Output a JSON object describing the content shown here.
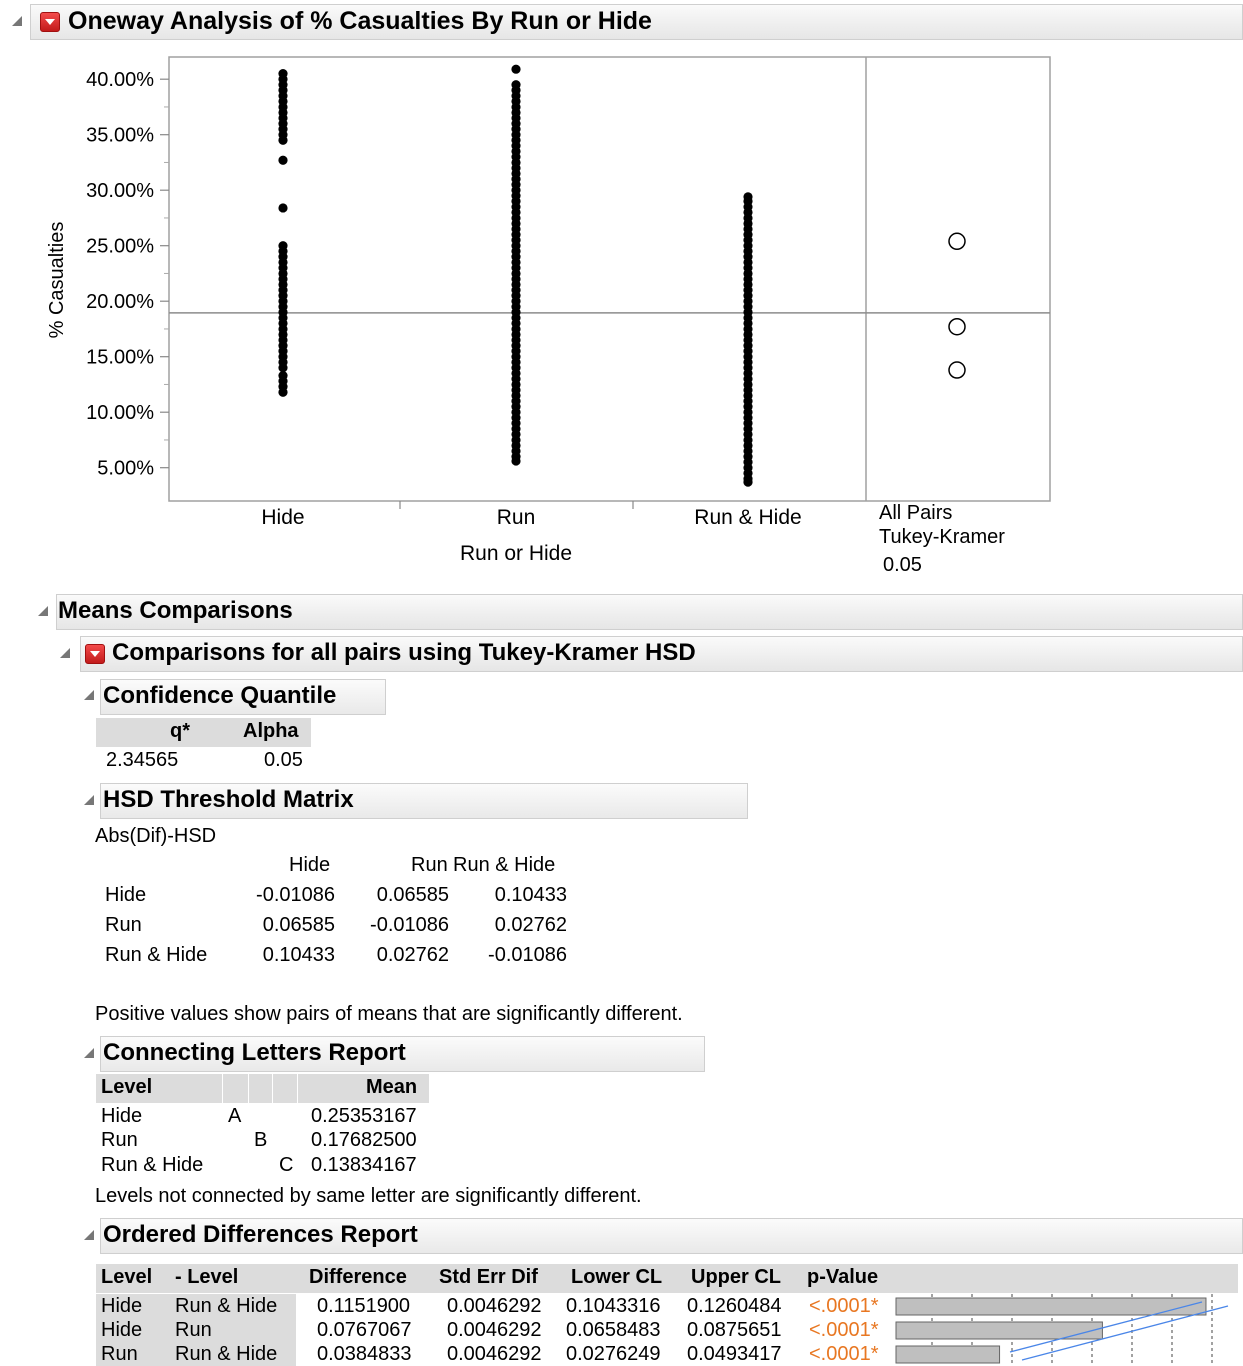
{
  "report": {
    "title": "Oneway Analysis of % Casualties By Run or Hide"
  },
  "chart_data": {
    "type": "scatter",
    "ylabel": "% Casualties",
    "xlabel": "Run or Hide",
    "categories": [
      "Hide",
      "Run",
      "Run & Hide"
    ],
    "y_ticks": [
      "5.00%",
      "10.00%",
      "15.00%",
      "20.00%",
      "25.00%",
      "30.00%",
      "35.00%",
      "40.00%"
    ],
    "ylim": [
      0.02,
      0.42
    ],
    "grand_mean": 0.1895,
    "series": [
      {
        "category": "Hide",
        "points": [
          0.118,
          0.123,
          0.128,
          0.133,
          0.14,
          0.145,
          0.15,
          0.155,
          0.16,
          0.165,
          0.17,
          0.175,
          0.18,
          0.185,
          0.19,
          0.195,
          0.2,
          0.205,
          0.21,
          0.215,
          0.22,
          0.225,
          0.23,
          0.235,
          0.24,
          0.245,
          0.25,
          0.284,
          0.327,
          0.345,
          0.35,
          0.355,
          0.36,
          0.365,
          0.37,
          0.375,
          0.38,
          0.385,
          0.39,
          0.395,
          0.4,
          0.405
        ]
      },
      {
        "category": "Run",
        "points": [
          0.056,
          0.06,
          0.065,
          0.07,
          0.075,
          0.08,
          0.085,
          0.09,
          0.095,
          0.1,
          0.105,
          0.11,
          0.115,
          0.12,
          0.125,
          0.13,
          0.135,
          0.14,
          0.145,
          0.15,
          0.155,
          0.16,
          0.165,
          0.17,
          0.175,
          0.18,
          0.185,
          0.19,
          0.195,
          0.2,
          0.205,
          0.21,
          0.215,
          0.22,
          0.225,
          0.23,
          0.235,
          0.24,
          0.245,
          0.25,
          0.255,
          0.26,
          0.265,
          0.27,
          0.275,
          0.28,
          0.285,
          0.29,
          0.295,
          0.3,
          0.305,
          0.31,
          0.315,
          0.32,
          0.325,
          0.33,
          0.335,
          0.34,
          0.345,
          0.35,
          0.355,
          0.36,
          0.365,
          0.37,
          0.375,
          0.38,
          0.385,
          0.39,
          0.395,
          0.409
        ]
      },
      {
        "category": "Run & Hide",
        "points": [
          0.037,
          0.04,
          0.045,
          0.05,
          0.055,
          0.06,
          0.065,
          0.07,
          0.075,
          0.08,
          0.085,
          0.09,
          0.095,
          0.1,
          0.105,
          0.11,
          0.115,
          0.12,
          0.125,
          0.13,
          0.135,
          0.14,
          0.145,
          0.15,
          0.155,
          0.16,
          0.165,
          0.17,
          0.175,
          0.18,
          0.185,
          0.19,
          0.195,
          0.2,
          0.205,
          0.21,
          0.215,
          0.22,
          0.225,
          0.23,
          0.235,
          0.24,
          0.245,
          0.25,
          0.255,
          0.26,
          0.265,
          0.27,
          0.275,
          0.28,
          0.285,
          0.29,
          0.294
        ]
      }
    ],
    "comparison_circles": [
      0.254,
      0.177,
      0.138
    ],
    "comparison_panel": {
      "line1": "All Pairs",
      "line2": "Tukey-Kramer",
      "alpha": "0.05"
    }
  },
  "means_comparisons": {
    "title": "Means Comparisons",
    "tukey_title": "Comparisons for all pairs using Tukey-Kramer HSD",
    "confidence_quantile": {
      "title": "Confidence Quantile",
      "headers": [
        "q*",
        "Alpha"
      ],
      "values": [
        "2.34565",
        "0.05"
      ]
    },
    "hsd": {
      "title": "HSD Threshold Matrix",
      "subtitle": "Abs(Dif)-HSD",
      "col_headers": [
        "Hide",
        "Run",
        "Run & Hide"
      ],
      "rows": [
        {
          "label": "Hide",
          "values": [
            "-0.01086",
            "0.06585",
            "0.10433"
          ]
        },
        {
          "label": "Run",
          "values": [
            "0.06585",
            "-0.01086",
            "0.02762"
          ]
        },
        {
          "label": "Run & Hide",
          "values": [
            "0.10433",
            "0.02762",
            "-0.01086"
          ]
        }
      ],
      "note": "Positive values show pairs of means that are significantly different."
    },
    "connecting_letters": {
      "title": "Connecting Letters Report",
      "headers": [
        "Level",
        "Mean"
      ],
      "rows": [
        {
          "level": "Hide",
          "letter": "A",
          "mean": "0.25353167"
        },
        {
          "level": "Run",
          "letter": "B",
          "mean": "0.17682500"
        },
        {
          "level": "Run & Hide",
          "letter": "C",
          "mean": "0.13834167"
        }
      ],
      "note": "Levels not connected by same letter are significantly different."
    },
    "ordered_differences": {
      "title": "Ordered Differences Report",
      "headers": [
        "Level",
        "- Level",
        "Difference",
        "Std Err Dif",
        "Lower CL",
        "Upper CL",
        "p-Value"
      ],
      "rows": [
        {
          "level": "Hide",
          "minus": "Run & Hide",
          "diff": "0.1151900",
          "se": "0.0046292",
          "lcl": "0.1043316",
          "ucl": "0.1260484",
          "p": "<.0001*",
          "bar": 0.11519
        },
        {
          "level": "Hide",
          "minus": "Run",
          "diff": "0.0767067",
          "se": "0.0046292",
          "lcl": "0.0658483",
          "ucl": "0.0875651",
          "p": "<.0001*",
          "bar": 0.0767067
        },
        {
          "level": "Run",
          "minus": "Run & Hide",
          "diff": "0.0384833",
          "se": "0.0046292",
          "lcl": "0.0276249",
          "ucl": "0.0493417",
          "p": "<.0001*",
          "bar": 0.0384833
        }
      ]
    }
  }
}
